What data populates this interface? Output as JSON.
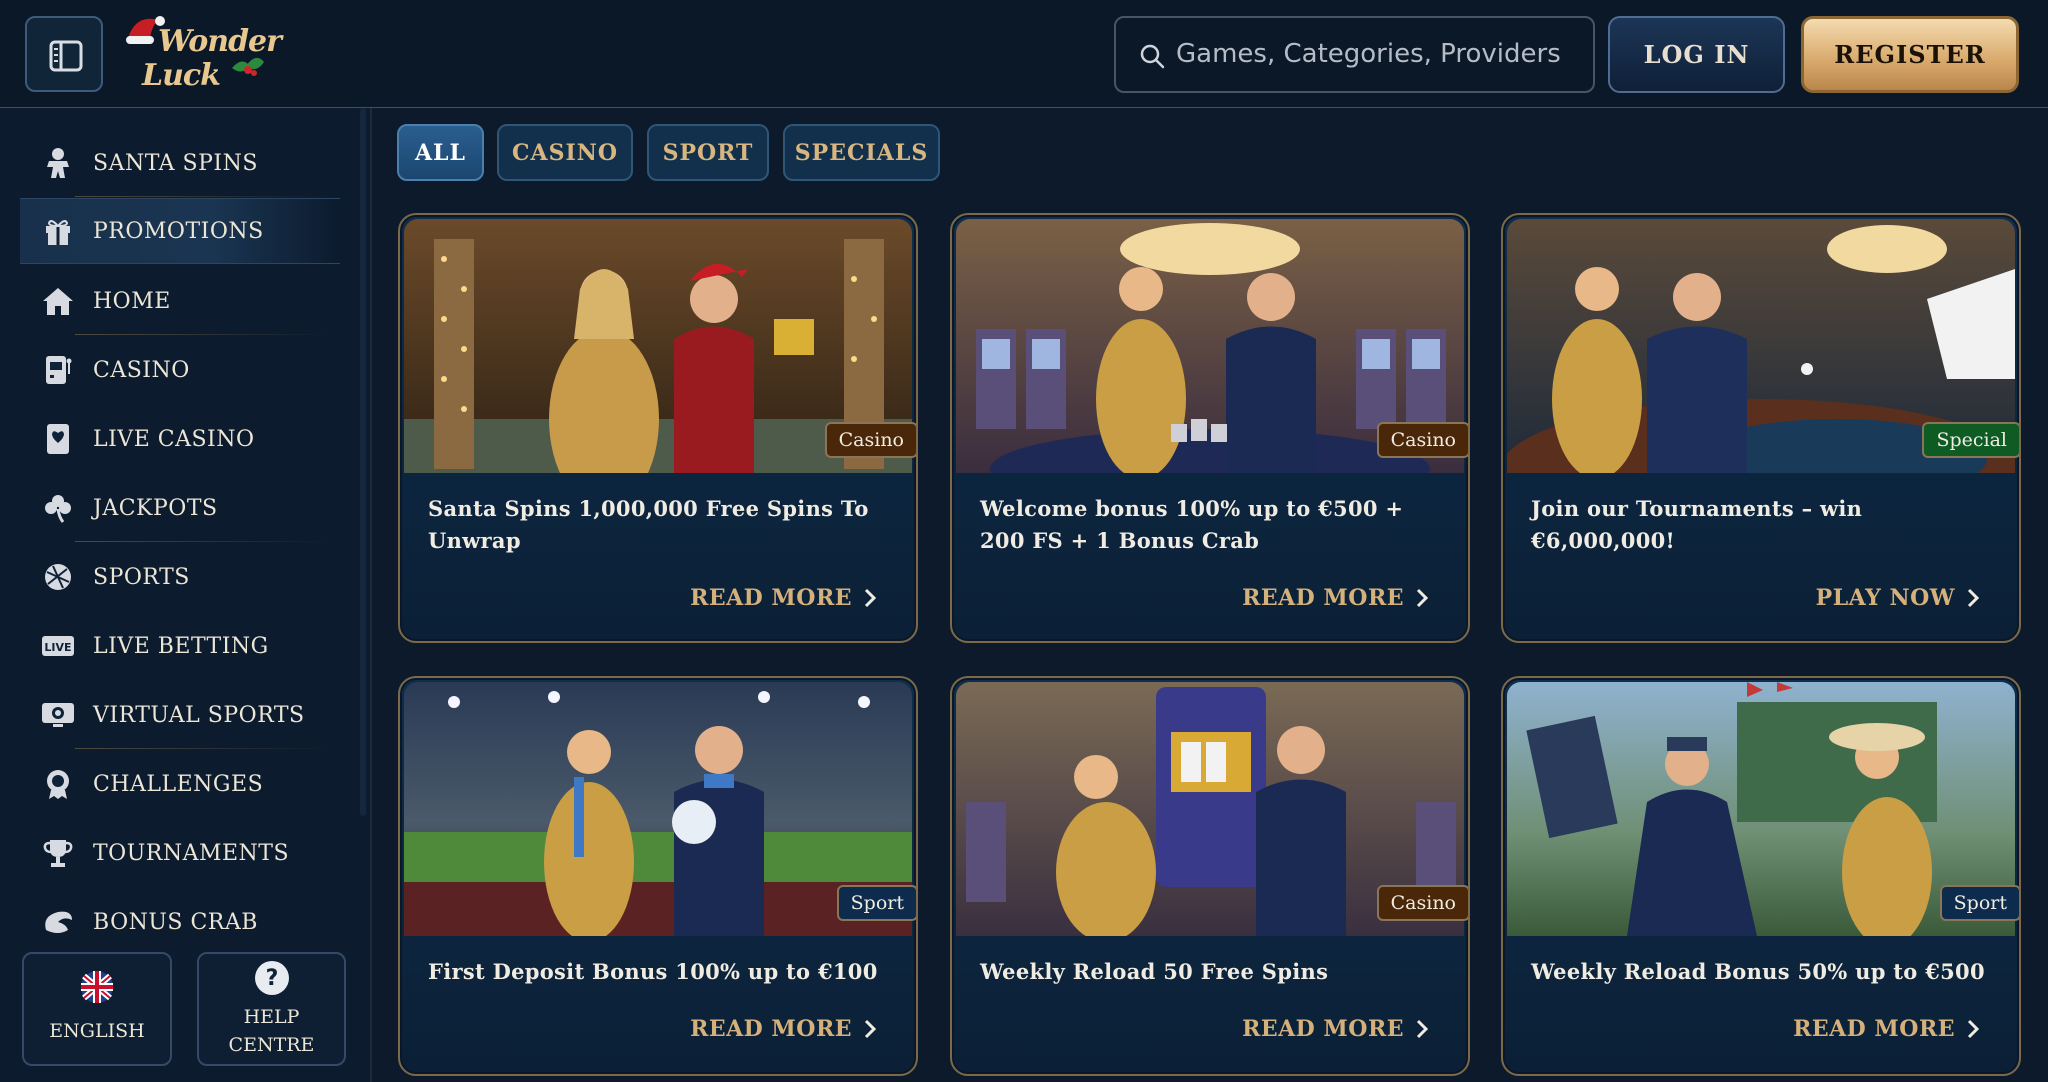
{
  "header": {
    "logo_line1": "Wonder",
    "logo_line2": "Luck",
    "search_placeholder": "Games, Categories, Providers",
    "login_label": "LOG IN",
    "register_label": "REGISTER"
  },
  "sidebar": {
    "items": [
      {
        "label": "SANTA SPINS",
        "icon": "gingerbread-icon"
      },
      {
        "label": "PROMOTIONS",
        "icon": "gift-icon",
        "active": true
      },
      {
        "label": "HOME",
        "icon": "home-icon"
      },
      {
        "label": "CASINO",
        "icon": "slot-machine-icon"
      },
      {
        "label": "LIVE CASINO",
        "icon": "playing-card-icon"
      },
      {
        "label": "JACKPOTS",
        "icon": "clover-icon"
      },
      {
        "label": "SPORTS",
        "icon": "sports-ball-icon"
      },
      {
        "label": "LIVE BETTING",
        "icon": "live-icon"
      },
      {
        "label": "VIRTUAL SPORTS",
        "icon": "virtual-sports-icon"
      },
      {
        "label": "CHALLENGES",
        "icon": "challenge-badge-icon"
      },
      {
        "label": "TOURNAMENTS",
        "icon": "trophy-icon"
      },
      {
        "label": "BONUS CRAB",
        "icon": "crab-claw-icon"
      }
    ],
    "language_label": "ENGLISH",
    "help_label_line1": "HELP",
    "help_label_line2": "CENTRE"
  },
  "filters": {
    "tabs": [
      {
        "label": "ALL",
        "active": true
      },
      {
        "label": "CASINO"
      },
      {
        "label": "SPORT"
      },
      {
        "label": "SPECIALS"
      }
    ]
  },
  "promotions": [
    {
      "badge": "Casino",
      "title_line1": "Santa Spins 1,000,000 Free Spins To",
      "title_line2": "Unwrap",
      "cta": "READ MORE"
    },
    {
      "badge": "Casino",
      "title_line1": "Welcome bonus 100% up to €500 +",
      "title_line2": "200 FS + 1 Bonus Crab",
      "cta": "READ MORE"
    },
    {
      "badge": "Special",
      "title_line1": "Join our Tournaments – win",
      "title_line2": "€6,000,000!",
      "cta": "PLAY NOW"
    },
    {
      "badge": "Sport",
      "title_line1": "First Deposit Bonus 100% up to €100",
      "title_line2": "",
      "cta": "READ MORE"
    },
    {
      "badge": "Casino",
      "title_line1": "Weekly Reload 50 Free Spins",
      "title_line2": "",
      "cta": "READ MORE"
    },
    {
      "badge": "Sport",
      "title_line1": "Weekly Reload Bonus 50% up to €500",
      "title_line2": "",
      "cta": "READ MORE"
    }
  ]
}
